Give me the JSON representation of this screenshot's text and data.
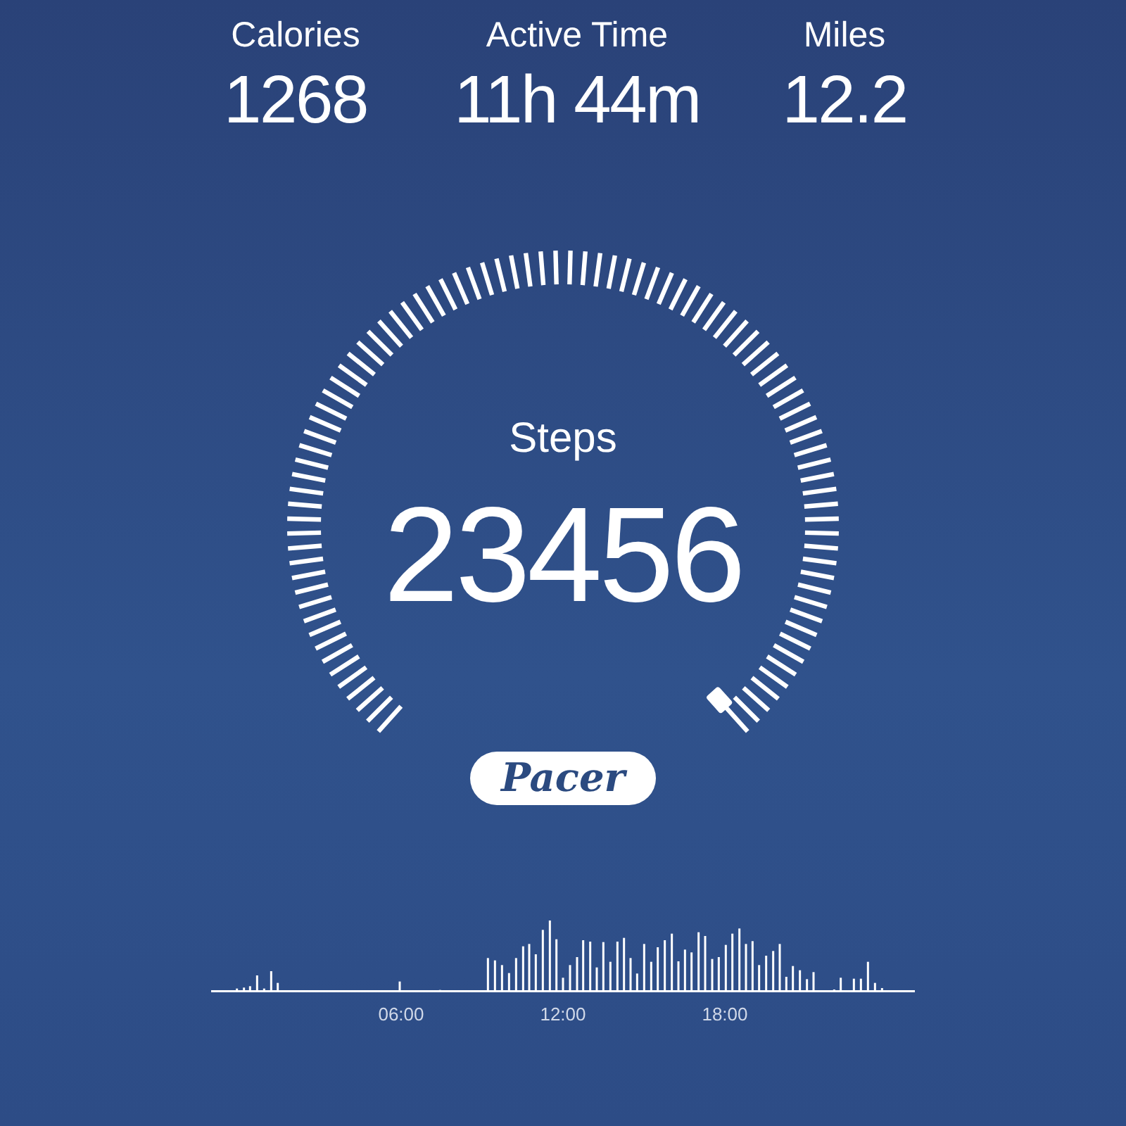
{
  "stats": [
    {
      "label": "Calories",
      "value": "1268"
    },
    {
      "label": "Active Time",
      "value": "11h 44m"
    },
    {
      "label": "Miles",
      "value": "12.2"
    }
  ],
  "gauge": {
    "label": "Steps",
    "value": "23456"
  },
  "brand": "Pacer",
  "activity_chart": {
    "time_labels": [
      "06:00",
      "12:00",
      "18:00"
    ]
  }
}
